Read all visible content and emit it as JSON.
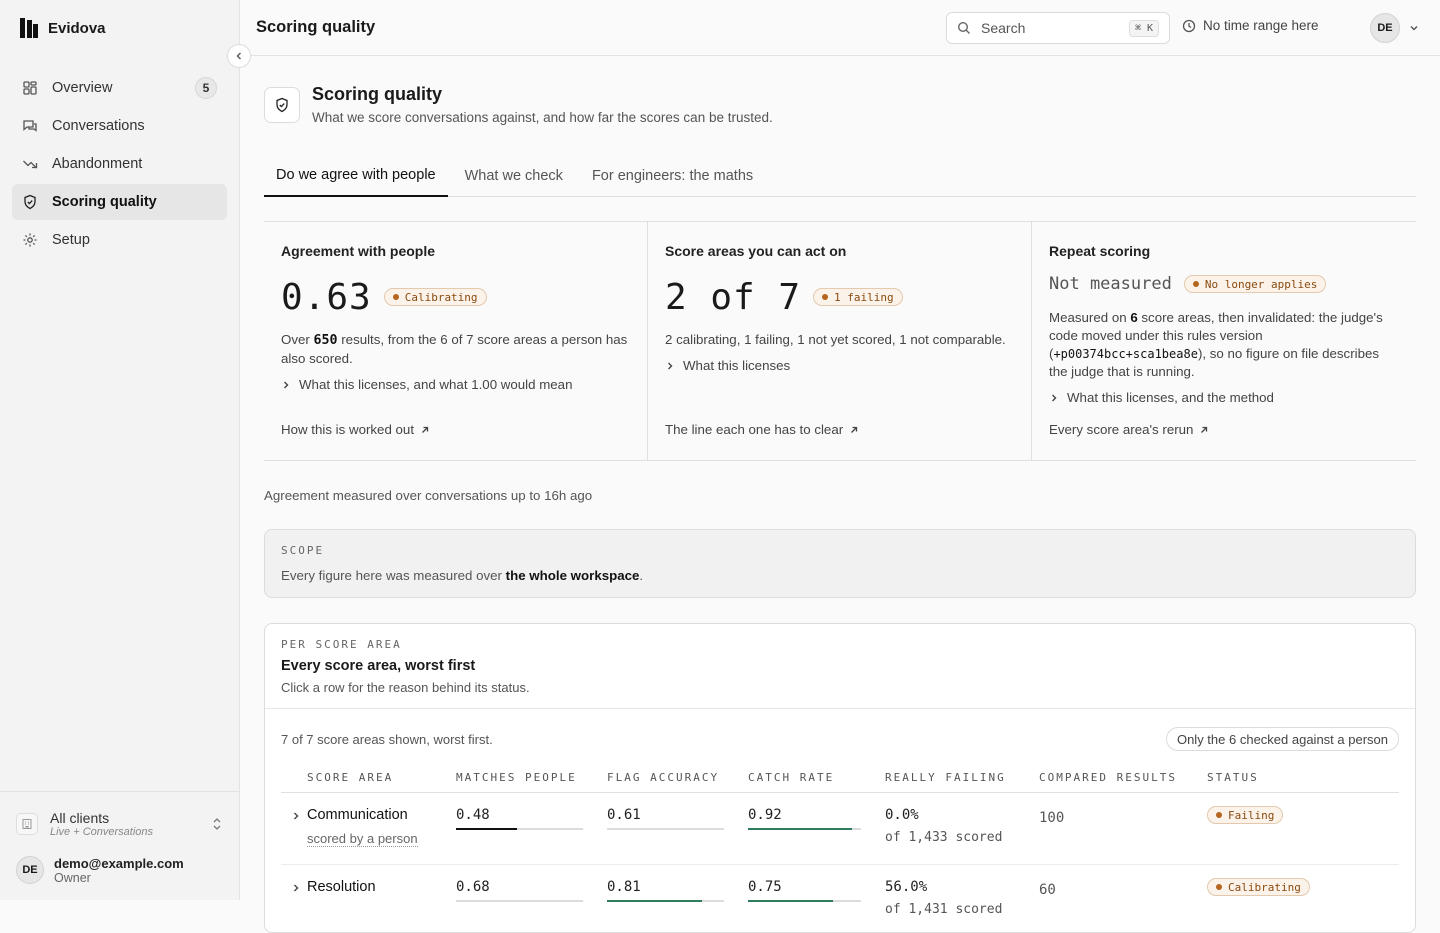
{
  "app": {
    "brand": "Evidova",
    "nav": [
      {
        "label": "Overview",
        "icon": "grid-icon",
        "badge": "5"
      },
      {
        "label": "Conversations",
        "icon": "chat-icon"
      },
      {
        "label": "Abandonment",
        "icon": "trend-down-icon"
      },
      {
        "label": "Scoring quality",
        "icon": "shield-check-icon",
        "active": true
      },
      {
        "label": "Setup",
        "icon": "gear-icon"
      }
    ],
    "client": {
      "name": "All clients",
      "sub": "Live + Conversations"
    },
    "user": {
      "initials": "DE",
      "email": "demo@example.com",
      "role": "Owner"
    }
  },
  "topbar": {
    "title": "Scoring quality",
    "search_placeholder": "Search",
    "search_shortcut": "⌘ K",
    "time_range": "No time range here",
    "avatar_initials": "DE"
  },
  "page": {
    "title": "Scoring quality",
    "subtitle": "What we score conversations against, and how far the scores can be trusted.",
    "tabs": [
      "Do we agree with people",
      "What we check",
      "For engineers: the maths"
    ],
    "active_tab": 0
  },
  "cards": {
    "agreement": {
      "title": "Agreement with people",
      "value": "0.63",
      "status": "Calibrating",
      "body_pre": "Over ",
      "body_num": "650",
      "body_post": " results, from the 6 of 7 score areas a person has also scored.",
      "disclose": "What this licenses, and what 1.00 would mean",
      "link": "How this is worked out"
    },
    "actionable": {
      "title": "Score areas you can act on",
      "value": "2 of 7",
      "status": "1 failing",
      "body": "2 calibrating, 1 failing, 1 not yet scored, 1 not comparable.",
      "disclose": "What this licenses",
      "link": "The line each one has to clear"
    },
    "repeat": {
      "title": "Repeat scoring",
      "value": "Not measured",
      "status": "No longer applies",
      "body_pre": "Measured on ",
      "body_num": "6",
      "body_mid": " score areas, then invalidated: the judge's code moved under this rules version (",
      "body_code": "+p00374bcc+sca1bea8e",
      "body_post": "), so no figure on file describes the judge that is running.",
      "disclose": "What this licenses, and the method",
      "link": "Every score area's rerun"
    }
  },
  "measured_note": "Agreement measured over conversations up to 16h  ago",
  "scope": {
    "eyebrow": "SCOPE",
    "text_pre": "Every figure here was measured over ",
    "text_bold": "the whole workspace",
    "text_post": "."
  },
  "per_area": {
    "eyebrow": "PER SCORE AREA",
    "title": "Every score area, worst first",
    "subtitle": "Click a row for the reason behind its status.",
    "count": "7 of 7 score areas shown, worst first.",
    "filter": "Only the 6 checked against a person",
    "columns": [
      "SCORE AREA",
      "MATCHES PEOPLE",
      "FLAG ACCURACY",
      "CATCH RATE",
      "REALLY FAILING",
      "COMPARED RESULTS",
      "STATUS"
    ],
    "rows": [
      {
        "name": "Communication",
        "sub": "scored by a person",
        "matches": "0.48",
        "matches_v": 0.48,
        "flag": "0.61",
        "flag_v": 0.61,
        "catch": "0.92",
        "catch_v": 0.92,
        "failing": "0.0%",
        "failing_sub": "of 1,433 scored",
        "compared": "100",
        "status": "Failing"
      },
      {
        "name": "Resolution",
        "sub": "",
        "matches": "0.68",
        "matches_v": 0.68,
        "flag": "0.81",
        "flag_v": 0.81,
        "catch": "0.75",
        "catch_v": 0.75,
        "failing": "56.0%",
        "failing_sub": "of 1,431 scored",
        "compared": "60",
        "status": "Calibrating"
      }
    ]
  },
  "colors": {
    "accent_bar_black": "#111111",
    "accent_bar_green": "#2e7d5b",
    "warn_pill": "#b5651d"
  }
}
